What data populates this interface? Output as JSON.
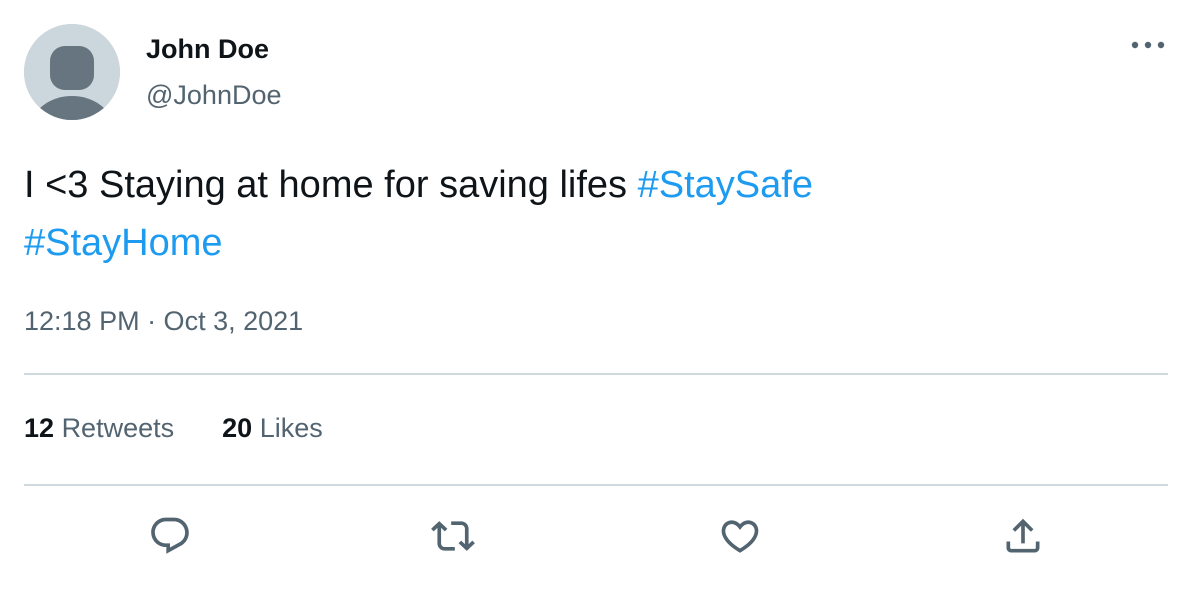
{
  "author": {
    "name": "John Doe",
    "handle": "@JohnDoe",
    "avatar_icon": "default-avatar-icon"
  },
  "tweet": {
    "text": "I <3 Staying at home for saving lifes",
    "hashtags": [
      "#StaySafe",
      "#StayHome"
    ],
    "timestamp": "12:18 PM · Oct 3, 2021"
  },
  "stats": {
    "retweets_count": "12",
    "retweets_label": "Retweets",
    "likes_count": "20",
    "likes_label": "Likes"
  },
  "actions": {
    "icons": [
      "reply-icon",
      "retweet-icon",
      "like-icon",
      "share-icon"
    ]
  },
  "colors": {
    "hashtag": "#1d9bf0",
    "secondary_text": "#536471",
    "divider": "#cfd9de",
    "avatar_bg": "#ccd6dd",
    "avatar_figure": "#66757f"
  }
}
